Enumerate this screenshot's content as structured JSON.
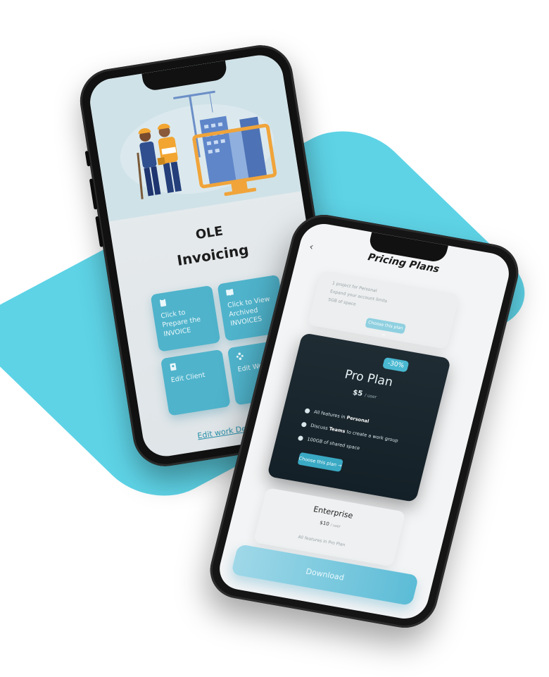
{
  "invoicing_app": {
    "title_line1": "OLE",
    "title_line2": "Invoicing",
    "tiles": [
      {
        "label": "Click to Prepare the INVOICE",
        "icon": "clipboard-icon"
      },
      {
        "label": "Click to View Archived INVOICES",
        "icon": "book-icon"
      },
      {
        "label": "Edit Client",
        "icon": "client-icon"
      },
      {
        "label": "Edit Worker",
        "icon": "worker-icon"
      }
    ],
    "edit_link": "Edit work Descriptions"
  },
  "pricing_app": {
    "title": "Pricing Plans",
    "basic_card": {
      "features": [
        "1 project for Personal",
        "Expand your account limits",
        "5GB of space"
      ],
      "button": "Choose this plan →"
    },
    "pro_card": {
      "badge": "-30%",
      "name": "Pro Plan",
      "price": "$5",
      "price_unit": "/ user",
      "features": [
        {
          "pre": "All features in ",
          "bold": "Personal",
          "post": ""
        },
        {
          "pre": "Discuss ",
          "bold": "Teams",
          "post": " to create a work group"
        },
        {
          "pre": "",
          "bold": "",
          "post": "100GB of shared space"
        }
      ],
      "button": "Choose this plan →"
    },
    "enterprise_card": {
      "name": "Enterprise",
      "price": "$10",
      "price_unit": "/ user",
      "feature": "All features in Pro Plan"
    },
    "download_button": "Download"
  },
  "colors": {
    "accent": "#4fb3cb",
    "background_shape": "#5ed3e6",
    "pro_card": "#1f2c33"
  }
}
